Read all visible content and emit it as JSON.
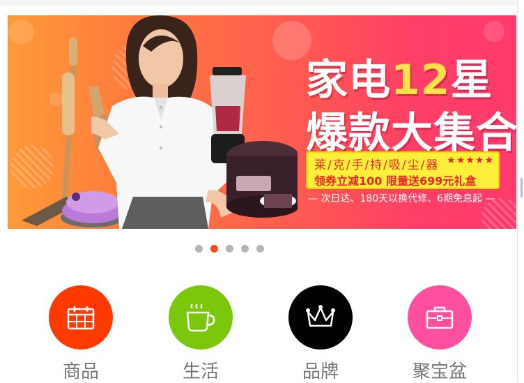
{
  "banner": {
    "headline_line1_prefix": "家电",
    "headline_number": "12",
    "headline_line1_suffix": "星",
    "headline_line2": "爆款大集合",
    "promo_line1": "莱/克/手/持/吸/尘/器",
    "promo_stars": "★★★★★",
    "promo_line2": "领券立减100 限量送699元礼盒",
    "tagline": "— 次日达、180天以换代修、6期免息起 —"
  },
  "carousel": {
    "slide_count": 5,
    "active_index": 1
  },
  "categories": [
    {
      "label": "商品",
      "icon": "calendar-icon",
      "color": "#ff3a00"
    },
    {
      "label": "生活",
      "icon": "coffee-cup-icon",
      "color": "#7ac70c"
    },
    {
      "label": "品牌",
      "icon": "crown-icon",
      "color": "#000000"
    },
    {
      "label": "聚宝盆",
      "icon": "briefcase-icon",
      "color": "#ff4fa0"
    }
  ]
}
